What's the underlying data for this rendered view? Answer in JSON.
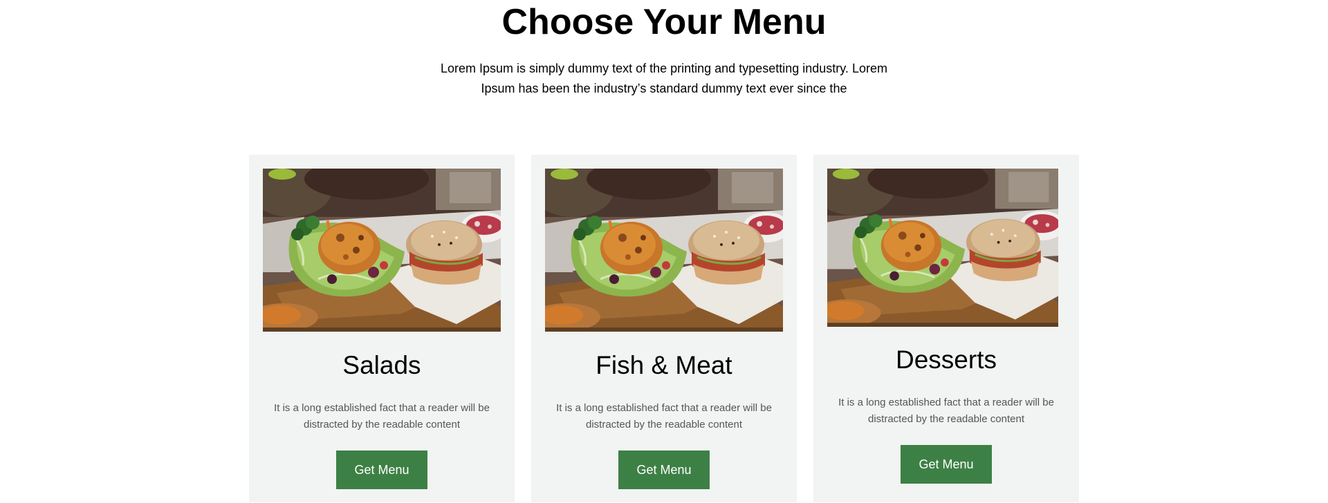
{
  "section": {
    "title": "Choose Your Menu",
    "subtitle": "Lorem Ipsum is simply dummy text of the printing and typesetting industry. Lorem Ipsum has been the industry’s standard dummy text ever since the"
  },
  "cards": [
    {
      "title": "Salads",
      "text": "It is a long established fact that a reader will be distracted by the readable content",
      "button_label": "Get Menu"
    },
    {
      "title": "Fish & Meat",
      "text": "It is a long established fact that a reader will be distracted by the readable content",
      "button_label": "Get Menu"
    },
    {
      "title": "Desserts",
      "text": "It is a long established fact that a reader will be distracted by the readable content",
      "button_label": "Get Menu"
    }
  ],
  "colors": {
    "card_background": "#f1f4f3",
    "button_background": "#3d8045",
    "button_text": "#ffffff",
    "body_text": "#555555"
  }
}
